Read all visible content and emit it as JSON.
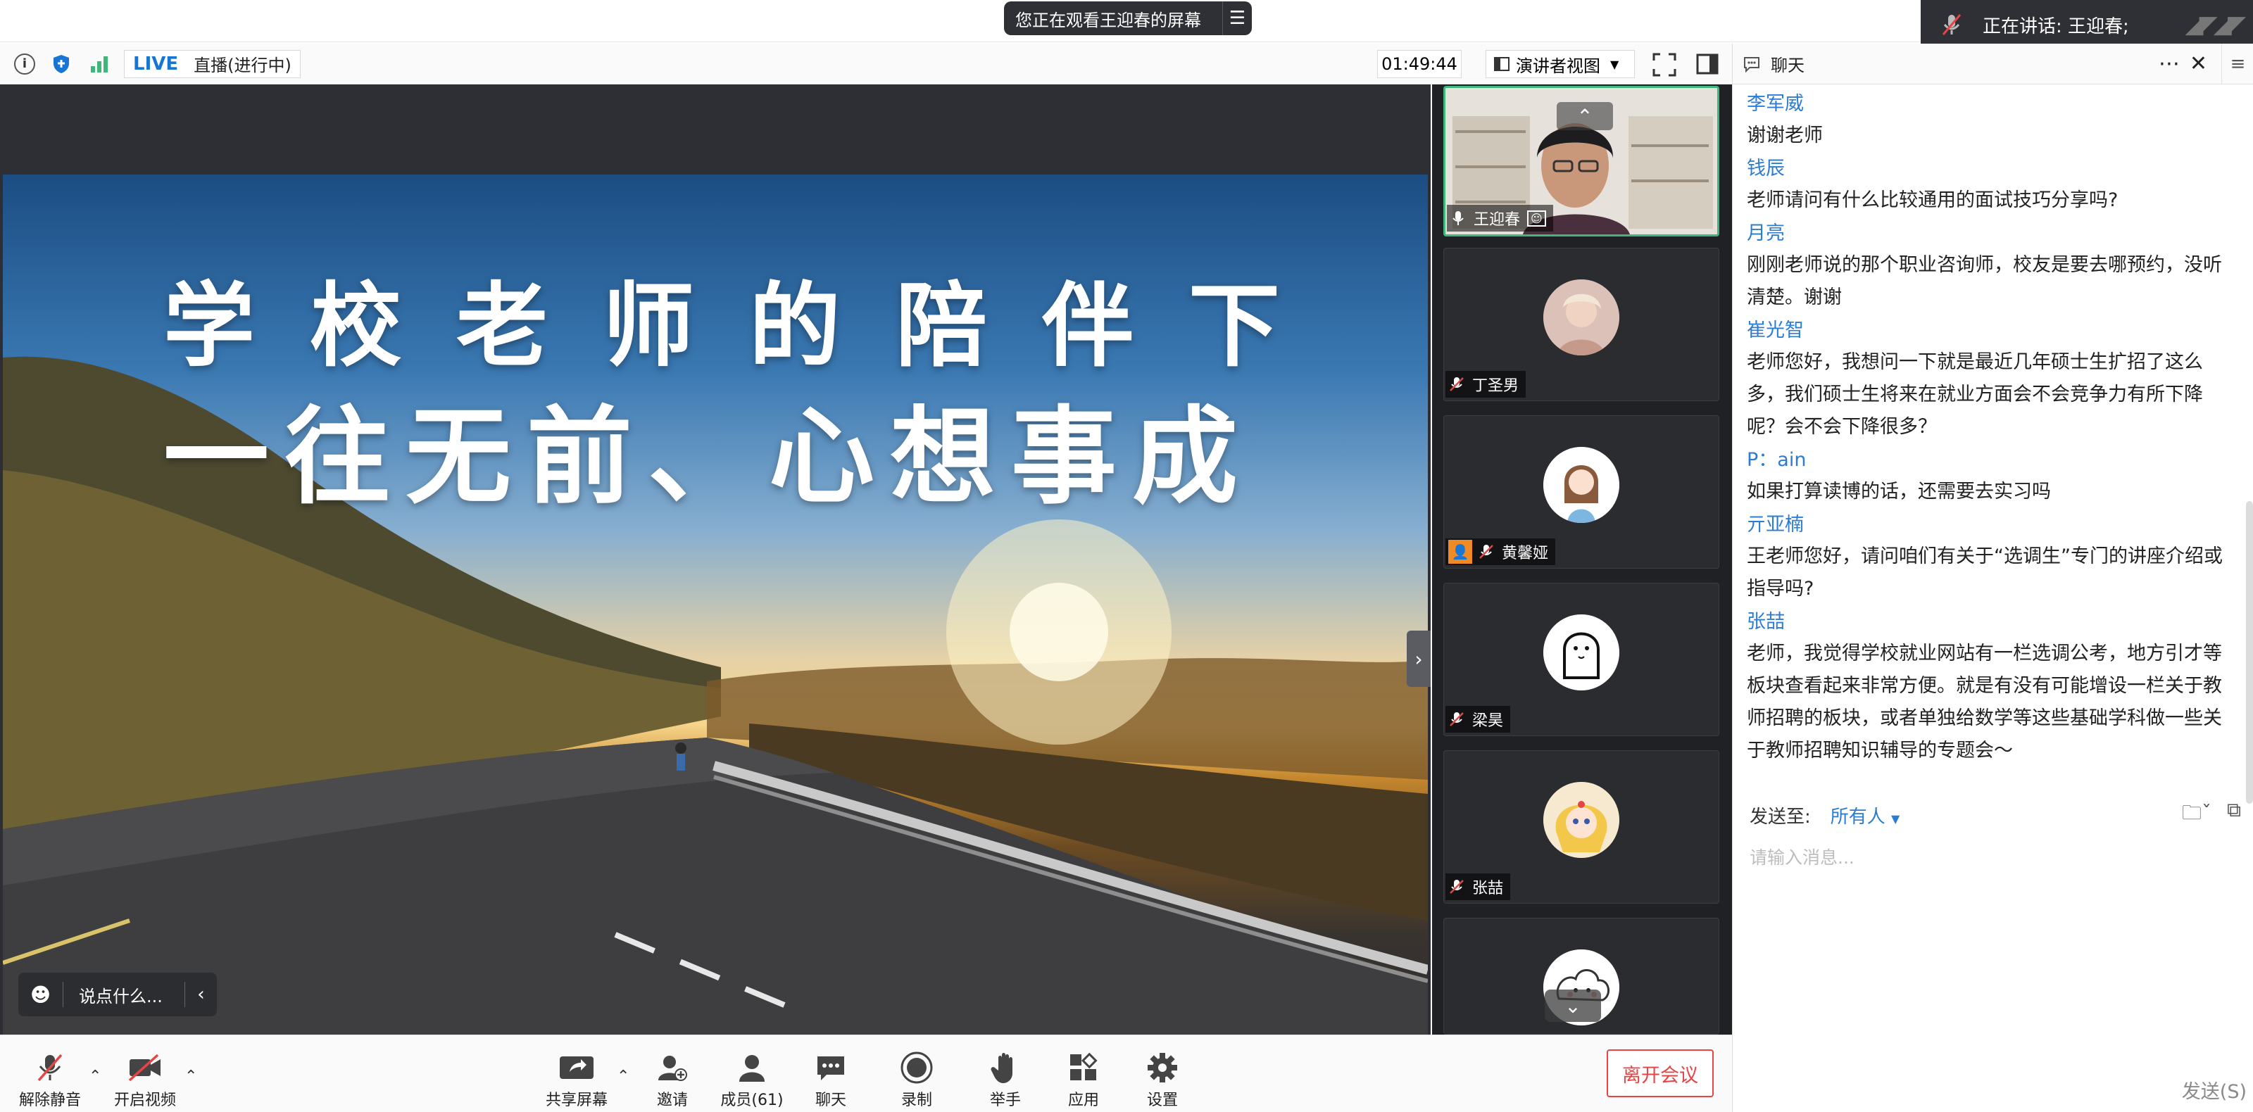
{
  "banner": {
    "watching": "您正在观看王迎春的屏幕",
    "speaking": "正在讲话: 王迎春;"
  },
  "toolbar": {
    "live_label": "LIVE",
    "live_status": "直播(进行中)",
    "timer": "01:49:44",
    "view_mode": "演讲者视图"
  },
  "slide": {
    "line1": "学校老师的陪伴下",
    "line2": "一往无前、心想事成"
  },
  "comment_bar": {
    "placeholder": "说点什么..."
  },
  "participants": [
    {
      "name": "王迎春",
      "muted": false
    },
    {
      "name": "丁圣男",
      "muted": true
    },
    {
      "name": "黄馨娅",
      "muted": true
    },
    {
      "name": "梁昊",
      "muted": true
    },
    {
      "name": "张喆",
      "muted": true
    },
    {
      "name": "",
      "muted": true
    }
  ],
  "chat": {
    "title": "聊天",
    "messages": [
      {
        "name": "李军威",
        "text": "谢谢老师"
      },
      {
        "name": "钱辰",
        "text": "老师请问有什么比较通用的面试技巧分享吗?"
      },
      {
        "name": "月亮",
        "text": "刚刚老师说的那个职业咨询师，校友是要去哪预约，没听清楚。谢谢"
      },
      {
        "name": "崔光智",
        "text": "老师您好，我想问一下就是最近几年硕士生扩招了这么多，我们硕士生将来在就业方面会不会竞争力有所下降呢？会不会下降很多？"
      },
      {
        "name": "P：ain",
        "text": "如果打算读博的话，还需要去实习吗"
      },
      {
        "name": "亓亚楠",
        "text": "王老师您好，请问咱们有关于“选调生”专门的讲座介绍或指导吗?"
      },
      {
        "name": "张喆",
        "text": "老师，我觉得学校就业网站有一栏选调公考，地方引才等板块查看起来非常方便。就是有没有可能增设一栏关于教师招聘的板块，或者单独给数学等这些基础学科做一些关于教师招聘知识辅导的专题会～"
      }
    ],
    "send_to_label": "发送至:",
    "send_to_target": "所有人",
    "input_placeholder": "请输入消息...",
    "send_button": "发送(S)"
  },
  "bottombar": {
    "unmute": "解除静音",
    "start_video": "开启视频",
    "share_screen": "共享屏幕",
    "invite": "邀请",
    "members": "成员(61)",
    "chat": "聊天",
    "record": "录制",
    "raise_hand": "举手",
    "apps": "应用",
    "settings": "设置",
    "leave": "离开会议"
  },
  "colors": {
    "accent_blue": "#2b7cd3",
    "live_blue": "#1776d2",
    "active_green": "#3fb67a",
    "danger_red": "#e64545",
    "dark_bg": "#202124"
  }
}
